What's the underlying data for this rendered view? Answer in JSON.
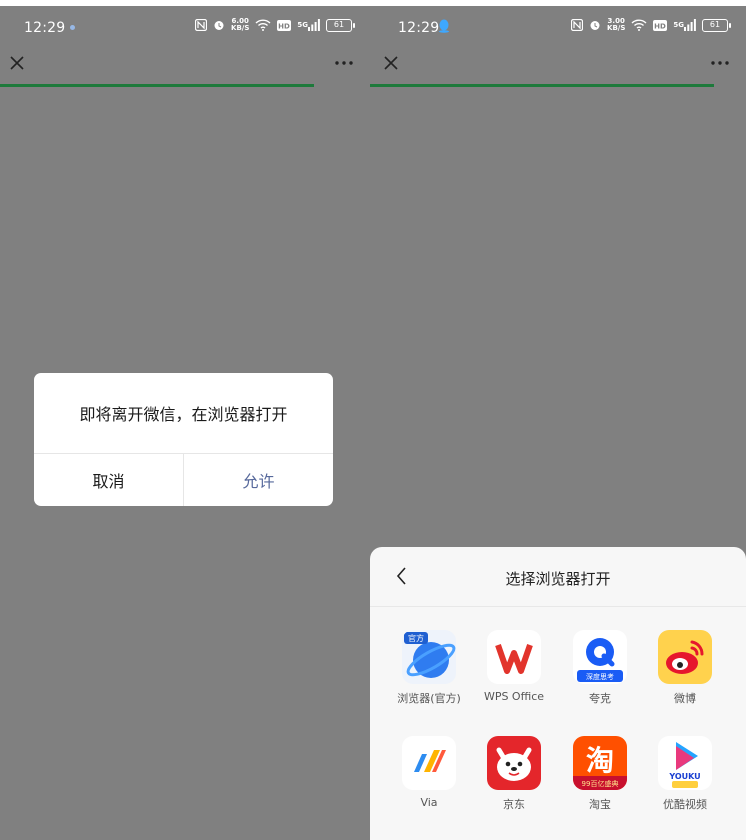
{
  "status": {
    "time": "12:29",
    "net_speed_left": "6.00",
    "net_speed_right": "3.00",
    "speed_unit": "KB/S",
    "battery": "61",
    "hd_label": "HD",
    "signal_label": "5G"
  },
  "dialog": {
    "message": "即将离开微信，在浏览器打开",
    "cancel_label": "取消",
    "allow_label": "允许"
  },
  "sheet": {
    "title": "选择浏览器打开",
    "apps": [
      {
        "label": "浏览器(官方)",
        "icon": "planet-browser-icon",
        "badge": "官方"
      },
      {
        "label": "WPS Office",
        "icon": "wps-icon"
      },
      {
        "label": "夸克",
        "icon": "quark-icon",
        "badge": "深度思考"
      },
      {
        "label": "微博",
        "icon": "weibo-icon"
      },
      {
        "label": "Via",
        "icon": "via-icon"
      },
      {
        "label": "京东",
        "icon": "jd-icon"
      },
      {
        "label": "淘宝",
        "icon": "taobao-icon",
        "glyph": "淘",
        "badge": "99百亿盛典"
      },
      {
        "label": "优酷视频",
        "icon": "youku-icon",
        "logo_text": "YOUKU"
      }
    ]
  },
  "colors": {
    "overlay": "#808080",
    "progress": "#1d7a3b",
    "allow": "#56689b"
  }
}
